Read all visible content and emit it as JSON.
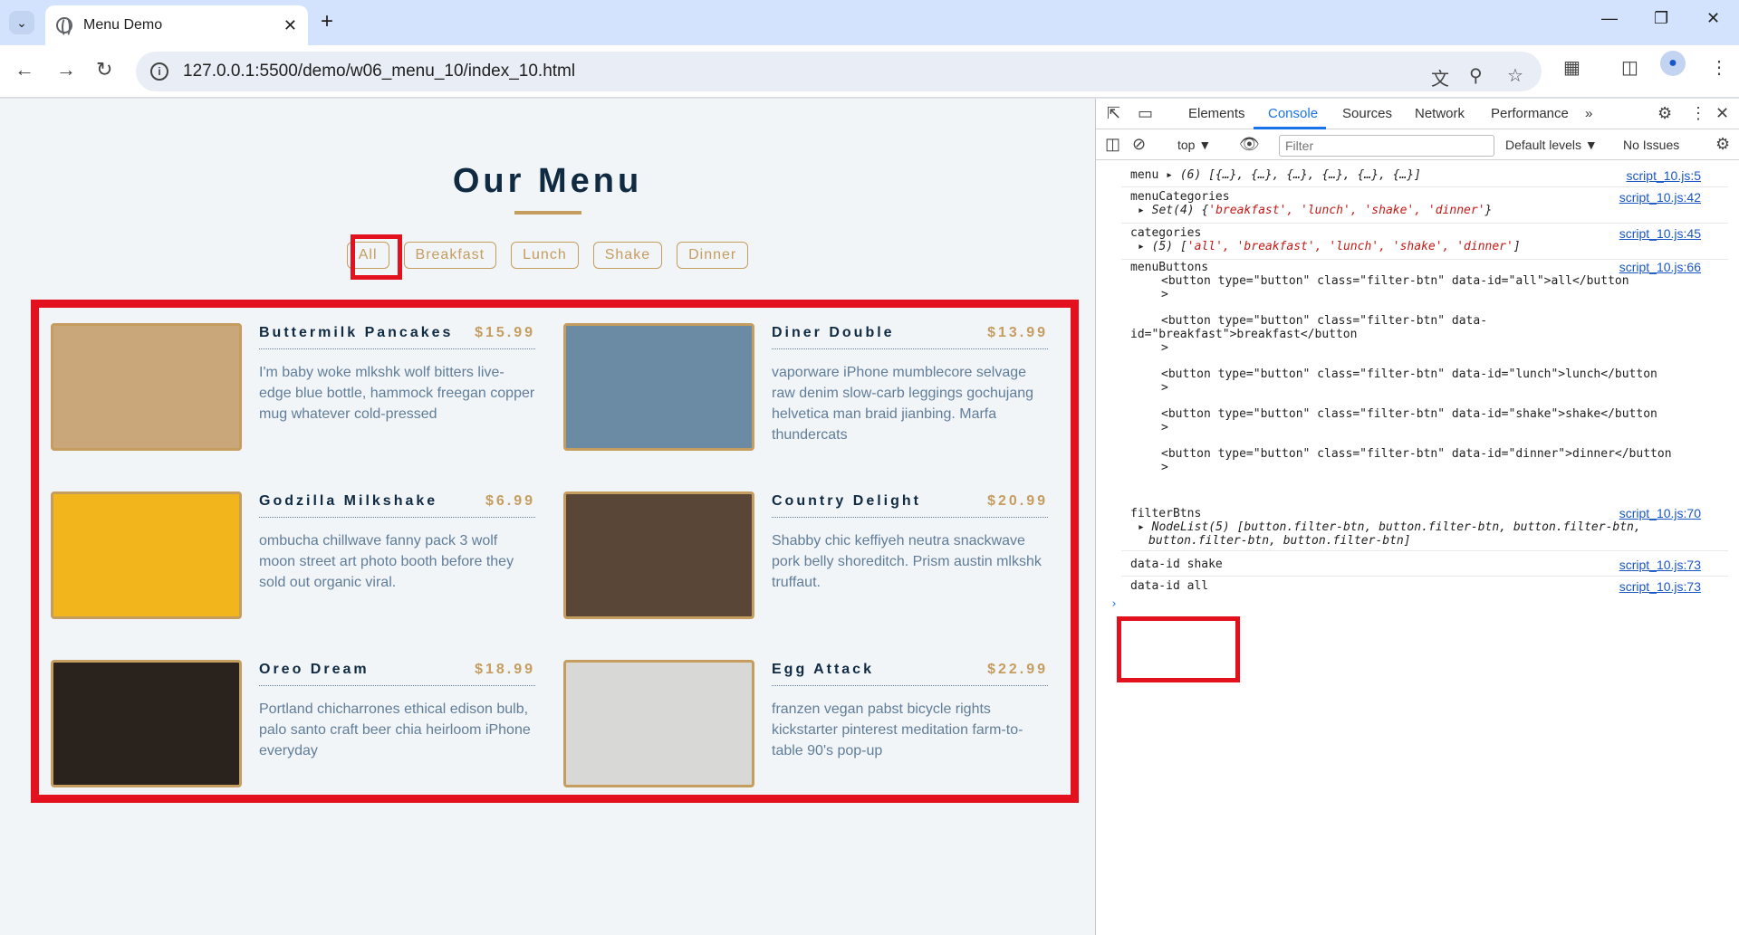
{
  "browser": {
    "tab_title": "Menu Demo",
    "url": "127.0.0.1:5500/demo/w06_menu_10/index_10.html"
  },
  "page": {
    "heading": "Our Menu",
    "filters": [
      "All",
      "Breakfast",
      "Lunch",
      "Shake",
      "Dinner"
    ],
    "items": [
      {
        "name": "Buttermilk Pancakes",
        "price": "$15.99",
        "desc": "I'm baby woke mlkshk wolf bitters live-edge blue bottle, hammock freegan copper mug whatever cold-pressed",
        "img_color": "#c9a77a"
      },
      {
        "name": "Diner Double",
        "price": "$13.99",
        "desc": "vaporware iPhone mumblecore selvage raw denim slow-carb leggings gochujang helvetica man braid jianbing. Marfa thundercats",
        "img_color": "#6b8aa3"
      },
      {
        "name": "Godzilla Milkshake",
        "price": "$6.99",
        "desc": "ombucha chillwave fanny pack 3 wolf moon street art photo booth before they sold out organic viral.",
        "img_color": "#f3b51c"
      },
      {
        "name": "Country Delight",
        "price": "$20.99",
        "desc": "Shabby chic keffiyeh neutra snackwave pork belly shoreditch. Prism austin mlkshk truffaut.",
        "img_color": "#5a4636"
      },
      {
        "name": "Oreo Dream",
        "price": "$18.99",
        "desc": "Portland chicharrones ethical edison bulb, palo santo craft beer chia heirloom iPhone everyday",
        "img_color": "#2a221d"
      },
      {
        "name": "Egg Attack",
        "price": "$22.99",
        "desc": "franzen vegan pabst bicycle rights kickstarter pinterest meditation farm-to-table 90's pop-up",
        "img_color": "#d8d8d6"
      }
    ]
  },
  "devtools": {
    "tabs": [
      "Elements",
      "Console",
      "Sources",
      "Network",
      "Performance"
    ],
    "context": "top",
    "filter_placeholder": "Filter",
    "levels": "Default levels",
    "issues": "No Issues",
    "messages": {
      "m1_label": "menu",
      "m1_val": "(6) [{…}, {…}, {…}, {…}, {…}, {…}]",
      "m1_src": "script_10.js:5",
      "m2_label": "menuCategories",
      "m2_val_pre": "Set(4) {",
      "m2_val_str": "'breakfast', 'lunch', 'shake', 'dinner'",
      "m2_val_post": "}",
      "m2_src": "script_10.js:42",
      "m3_label": "categories",
      "m3_val_pre": "(5) [",
      "m3_val_str": "'all', 'breakfast', 'lunch', 'shake', 'dinner'",
      "m3_val_post": "]",
      "m3_src": "script_10.js:45",
      "m4_label": "menuButtons",
      "m4_src": "script_10.js:66",
      "m4_l1": "<button type=\"button\" class=\"filter-btn\" data-id=\"all\">all</button",
      "m4_l2a": "<button type=\"button\" class=\"filter-btn\" data-",
      "m4_l2b": "id=\"breakfast\">breakfast</button",
      "m4_l3": "<button type=\"button\" class=\"filter-btn\" data-id=\"lunch\">lunch</button",
      "m4_l4": "<button type=\"button\" class=\"filter-btn\" data-id=\"shake\">shake</button",
      "m4_l5": "<button type=\"button\" class=\"filter-btn\" data-id=\"dinner\">dinner</button",
      "gt": ">",
      "m5_label": "filterBtns",
      "m5_val1": "NodeList(5) [button.filter-btn, button.filter-btn, button.filter-btn,",
      "m5_val2": "button.filter-btn, button.filter-btn]",
      "m5_src": "script_10.js:70",
      "m6": "data-id shake",
      "m6_src": "script_10.js:73",
      "m7": "data-id all",
      "m7_src": "script_10.js:73"
    }
  }
}
